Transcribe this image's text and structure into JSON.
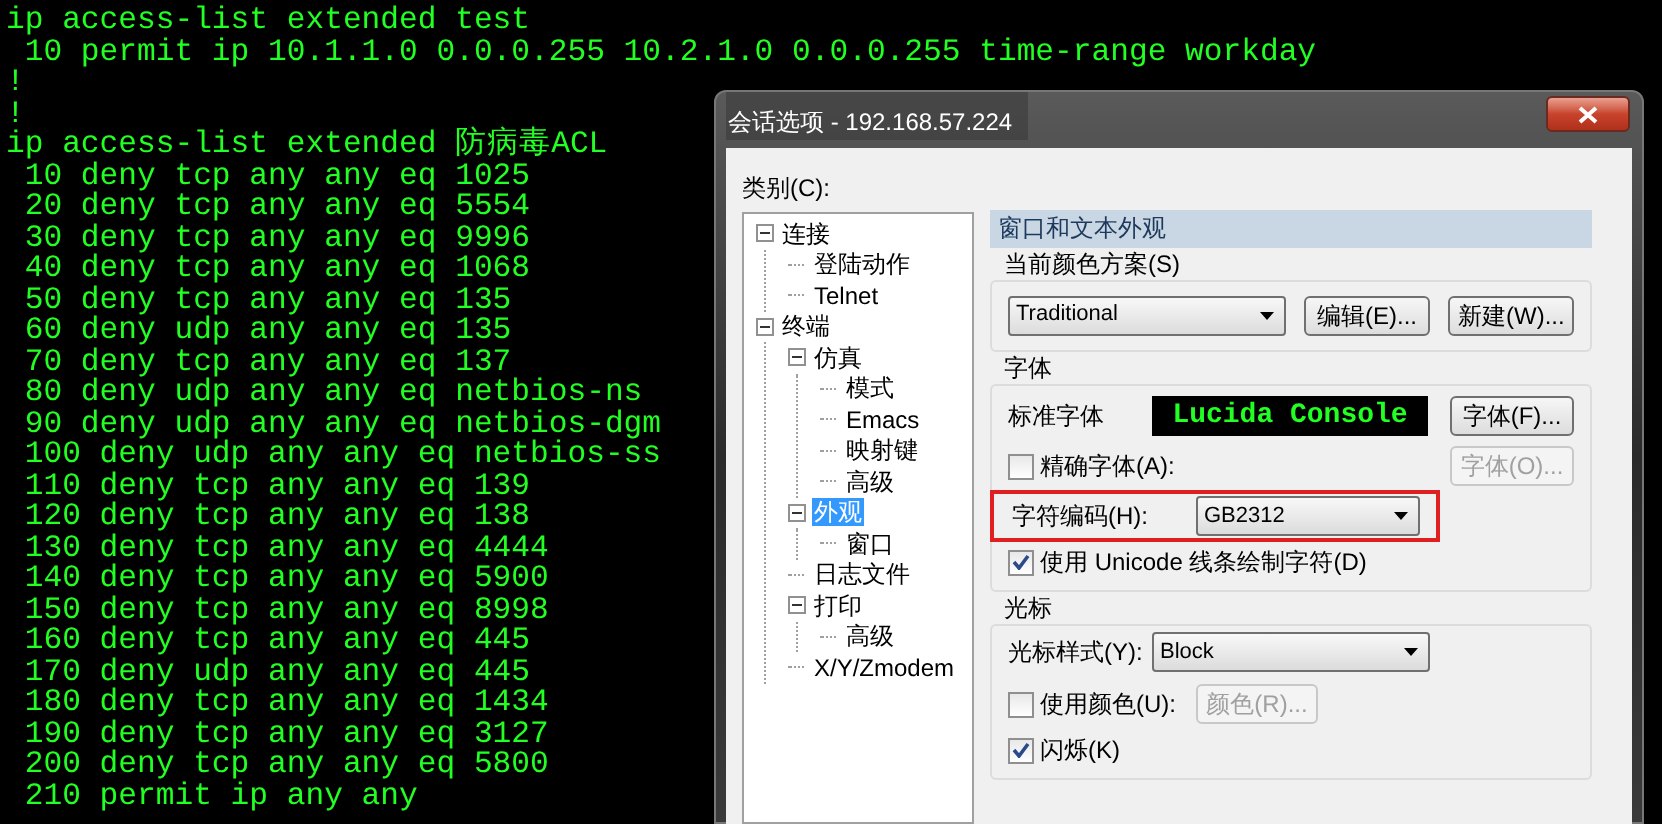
{
  "terminal": {
    "lines": [
      "ip access-list extended test",
      " 10 permit ip 10.1.1.0 0.0.0.255 10.2.1.0 0.0.0.255 time-range workday",
      "!",
      "!",
      "ip access-list extended 防病毒ACL",
      " 10 deny tcp any any eq 1025",
      " 20 deny tcp any any eq 5554",
      " 30 deny tcp any any eq 9996",
      " 40 deny tcp any any eq 1068",
      " 50 deny tcp any any eq 135",
      " 60 deny udp any any eq 135",
      " 70 deny tcp any any eq 137",
      " 80 deny udp any any eq netbios-ns",
      " 90 deny udp any any eq netbios-dgm",
      " 100 deny udp any any eq netbios-ss",
      " 110 deny tcp any any eq 139",
      " 120 deny tcp any any eq 138",
      " 130 deny tcp any any eq 4444",
      " 140 deny tcp any any eq 5900",
      " 150 deny tcp any any eq 8998",
      " 160 deny tcp any any eq 445",
      " 170 deny udp any any eq 445",
      " 180 deny tcp any any eq 1434",
      " 190 deny tcp any any eq 3127",
      " 200 deny tcp any any eq 5800",
      " 210 permit ip any any"
    ]
  },
  "dialog": {
    "title": "会话选项 - 192.168.57.224",
    "category_label": "类别(C):",
    "tree": [
      {
        "label": "连接",
        "selected": false,
        "expanded": true,
        "children": [
          {
            "label": "登陆动作",
            "selected": false
          },
          {
            "label": "Telnet",
            "selected": false
          }
        ]
      },
      {
        "label": "终端",
        "selected": false,
        "expanded": true,
        "children": [
          {
            "label": "仿真",
            "selected": false,
            "expanded": true,
            "children": [
              {
                "label": "模式",
                "selected": false
              },
              {
                "label": "Emacs",
                "selected": false
              },
              {
                "label": "映射键",
                "selected": false
              },
              {
                "label": "高级",
                "selected": false
              }
            ]
          },
          {
            "label": "外观",
            "selected": true,
            "expanded": true,
            "children": [
              {
                "label": "窗口",
                "selected": false
              }
            ]
          },
          {
            "label": "日志文件",
            "selected": false
          },
          {
            "label": "打印",
            "selected": false,
            "expanded": true,
            "children": [
              {
                "label": "高级",
                "selected": false
              }
            ]
          },
          {
            "label": "X/Y/Zmodem",
            "selected": false
          }
        ]
      }
    ],
    "panel": {
      "header": "窗口和文本外观",
      "color_scheme": {
        "label": "当前颜色方案(S)",
        "value": "Traditional",
        "buttons": [
          {
            "label": "编辑(E)...",
            "disabled": false
          },
          {
            "label": "新建(W)...",
            "disabled": false
          }
        ]
      },
      "font": {
        "label": "字体",
        "standard_label": "标准字体",
        "preview": "Lucida Console",
        "font_button": {
          "label": "字体(F)...",
          "disabled": false
        },
        "exact_font": {
          "label": "精确字体(A):",
          "checked": false
        },
        "exact_font_button": {
          "label": "字体(O)...",
          "disabled": true
        },
        "encoding": {
          "label": "字符编码(H):",
          "value": "GB2312",
          "highlighted": true
        },
        "unicode_lines": {
          "label": "使用 Unicode 线条绘制字符(D)",
          "checked": true
        }
      },
      "cursor": {
        "label": "光标",
        "style_label": "光标样式(Y):",
        "style_value": "Block",
        "use_color": {
          "label": "使用颜色(U):",
          "checked": false
        },
        "color_button": {
          "label": "颜色(R)...",
          "disabled": true
        },
        "blink": {
          "label": "闪烁(K)",
          "checked": true
        }
      }
    }
  }
}
